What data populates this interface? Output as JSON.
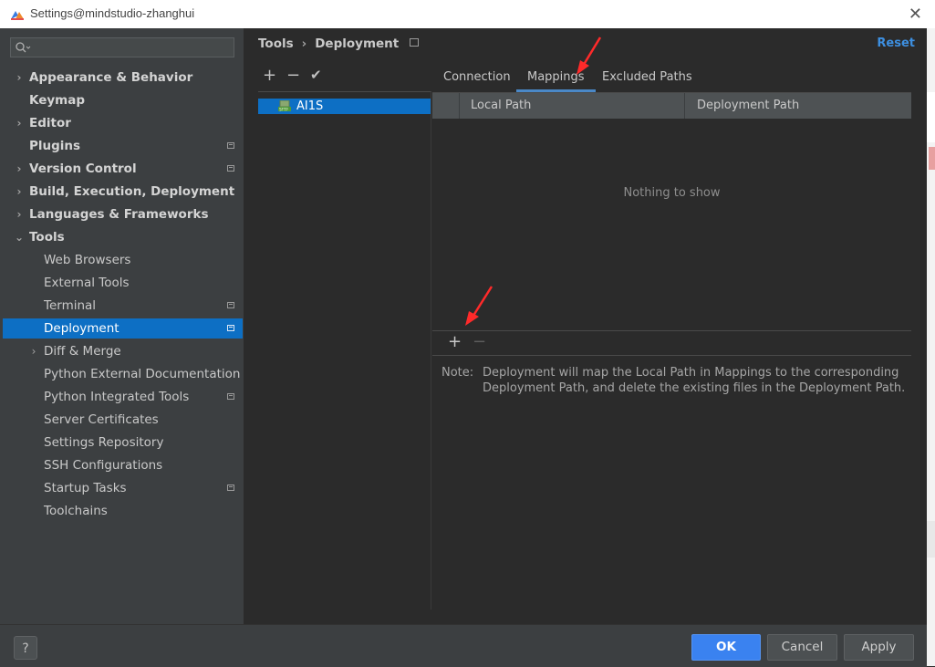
{
  "window": {
    "title": "Settings@mindstudio-zhanghui",
    "close_glyph": "✕"
  },
  "search": {
    "placeholder": "",
    "icon": "search-icon"
  },
  "sidebar": {
    "items": [
      {
        "label": "Appearance & Behavior",
        "bold": true,
        "chevron": "›",
        "project": false
      },
      {
        "label": "Keymap",
        "bold": true,
        "chevron": "",
        "project": false
      },
      {
        "label": "Editor",
        "bold": true,
        "chevron": "›",
        "project": false
      },
      {
        "label": "Plugins",
        "bold": true,
        "chevron": "",
        "project": true
      },
      {
        "label": "Version Control",
        "bold": true,
        "chevron": "›",
        "project": true
      },
      {
        "label": "Build, Execution, Deployment",
        "bold": true,
        "chevron": "›",
        "project": false
      },
      {
        "label": "Languages & Frameworks",
        "bold": true,
        "chevron": "›",
        "project": false
      },
      {
        "label": "Tools",
        "bold": true,
        "chevron": "⌄",
        "project": false
      },
      {
        "label": "Web Browsers",
        "bold": false,
        "chevron": "",
        "project": false
      },
      {
        "label": "External Tools",
        "bold": false,
        "chevron": "",
        "project": false
      },
      {
        "label": "Terminal",
        "bold": false,
        "chevron": "",
        "project": true
      },
      {
        "label": "Deployment",
        "bold": false,
        "chevron": "",
        "project": true,
        "selected": true
      },
      {
        "label": "Diff & Merge",
        "bold": false,
        "chevron": "›",
        "project": false
      },
      {
        "label": "Python External Documentation",
        "bold": false,
        "chevron": "",
        "project": false
      },
      {
        "label": "Python Integrated Tools",
        "bold": false,
        "chevron": "",
        "project": true
      },
      {
        "label": "Server Certificates",
        "bold": false,
        "chevron": "",
        "project": false
      },
      {
        "label": "Settings Repository",
        "bold": false,
        "chevron": "",
        "project": false
      },
      {
        "label": "SSH Configurations",
        "bold": false,
        "chevron": "",
        "project": false
      },
      {
        "label": "Startup Tasks",
        "bold": false,
        "chevron": "",
        "project": true
      },
      {
        "label": "Toolchains",
        "bold": false,
        "chevron": "",
        "project": false
      }
    ]
  },
  "breadcrumb": {
    "parent": "Tools",
    "separator": "›",
    "current": "Deployment"
  },
  "header": {
    "reset_label": "Reset"
  },
  "servers": {
    "toolbar": {
      "add": "+",
      "remove": "−",
      "default": "✔"
    },
    "items": [
      {
        "label": "AI1S",
        "selected": true
      }
    ]
  },
  "tabs": [
    {
      "label": "Connection",
      "active": false
    },
    {
      "label": "Mappings",
      "active": true
    },
    {
      "label": "Excluded Paths",
      "active": false
    }
  ],
  "mappings": {
    "columns": [
      "Local Path",
      "Deployment Path"
    ],
    "empty_text": "Nothing to show",
    "toolbar": {
      "add": "+",
      "remove": "−"
    }
  },
  "note": {
    "label": "Note:",
    "text": "Deployment will map the Local Path in Mappings to the corresponding Deployment Path, and delete the existing files in the Deployment Path."
  },
  "footer": {
    "help": "?",
    "ok": "OK",
    "cancel": "Cancel",
    "apply": "Apply"
  },
  "colors": {
    "accent": "#3a82f0",
    "selection": "#0d6fc4",
    "link": "#3d8fe0",
    "annotation_arrow": "#ff2a2a"
  }
}
